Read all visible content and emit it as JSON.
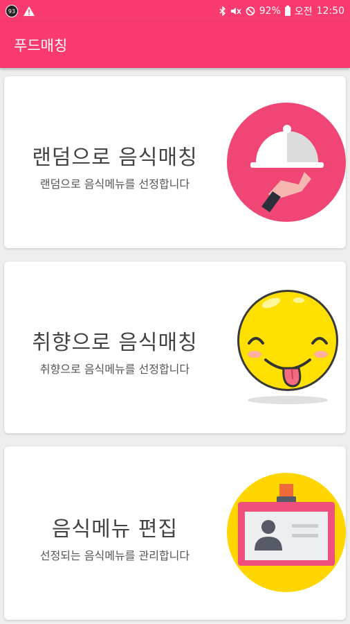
{
  "status_bar": {
    "notification_count": "93",
    "battery": "92%",
    "ampm": "오전",
    "time": "12:50"
  },
  "app_bar": {
    "title": "푸드매칭"
  },
  "cards": [
    {
      "title": "랜덤으로 음식매칭",
      "subtitle": "랜덤으로 음식메뉴를 선정합니다",
      "icon": "serving-cloche-icon"
    },
    {
      "title": "취향으로 음식매칭",
      "subtitle": "취향으로 음식메뉴를 선정합니다",
      "icon": "tongue-emoji-icon"
    },
    {
      "title": "음식메뉴 편집",
      "subtitle": "선정되는 음식메뉴를 관리합니다",
      "icon": "id-card-icon"
    }
  ],
  "colors": {
    "primary": "#f83a6f",
    "yellow": "#ffd600"
  }
}
